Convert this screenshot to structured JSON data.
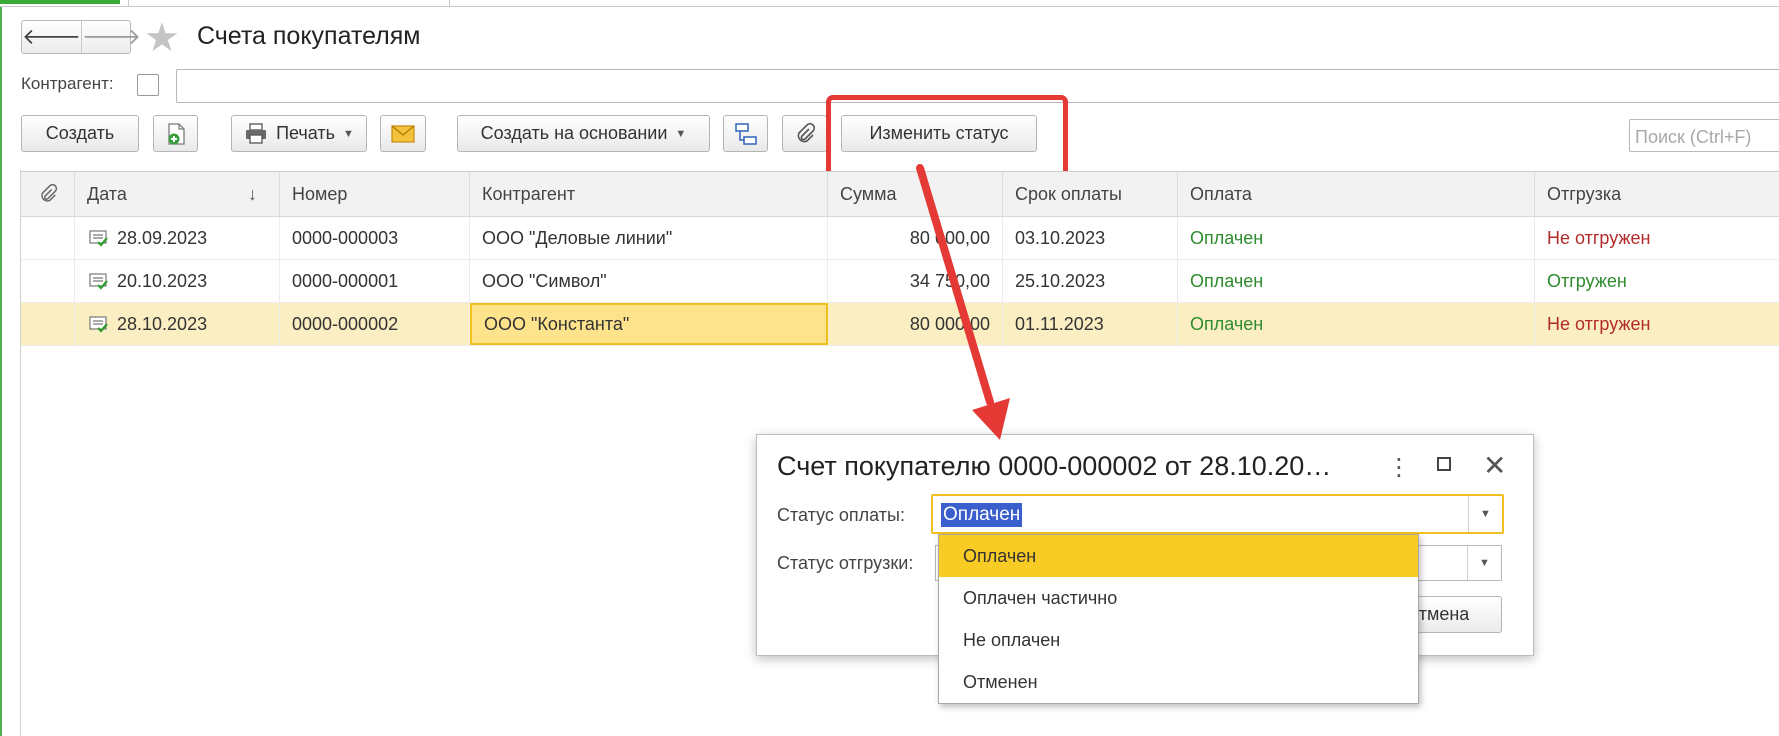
{
  "nav": {
    "back_glyph": "🡐",
    "forward_glyph": "🡒",
    "back_icon": "arrow-left-icon",
    "forward_icon": "arrow-right-icon",
    "favorite_icon": "star-icon"
  },
  "page_title": "Счета покупателям",
  "filter": {
    "counterparty_label": "Контрагент:",
    "counterparty_value": ""
  },
  "toolbar": {
    "create_label": "Создать",
    "print_label": "Печать",
    "create_based_label": "Создать на основании",
    "change_status_label": "Изменить статус",
    "search_placeholder": "Поиск (Ctrl+F)"
  },
  "table": {
    "columns": [
      "Дата",
      "Номер",
      "Контрагент",
      "Сумма",
      "Срок оплаты",
      "Оплата",
      "Отгрузка"
    ],
    "rows": [
      {
        "date": "28.09.2023",
        "number": "0000-000003",
        "counterparty": "ООО \"Деловые линии\"",
        "sum": "80 000,00",
        "due": "03.10.2023",
        "payment": "Оплачен",
        "shipment": "Не отгружен"
      },
      {
        "date": "20.10.2023",
        "number": "0000-000001",
        "counterparty": "ООО \"Символ\"",
        "sum": "34 750,00",
        "due": "25.10.2023",
        "payment": "Оплачен",
        "shipment": "Отгружен"
      },
      {
        "date": "28.10.2023",
        "number": "0000-000002",
        "counterparty": "ООО \"Константа\"",
        "sum": "80 000,00",
        "due": "01.11.2023",
        "payment": "Оплачен",
        "shipment": "Не отгружен"
      }
    ]
  },
  "dialog": {
    "title": "Счет покупателю 0000-000002 от 28.10.20…",
    "payment_status_label": "Статус оплаты:",
    "payment_status_value": "Оплачен",
    "shipment_status_label": "Статус отгрузки:",
    "cancel_label": "Отмена"
  },
  "dropdown": {
    "options": [
      "Оплачен",
      "Оплачен частично",
      "Не оплачен",
      "Отменен"
    ],
    "selected_index": 0
  },
  "colors": {
    "selected_row": "#fbeec3",
    "highlight": "#f9cb25",
    "paid": "#2e8b2e",
    "not_shipped": "#b22b2b",
    "annotation": "#e53935"
  }
}
